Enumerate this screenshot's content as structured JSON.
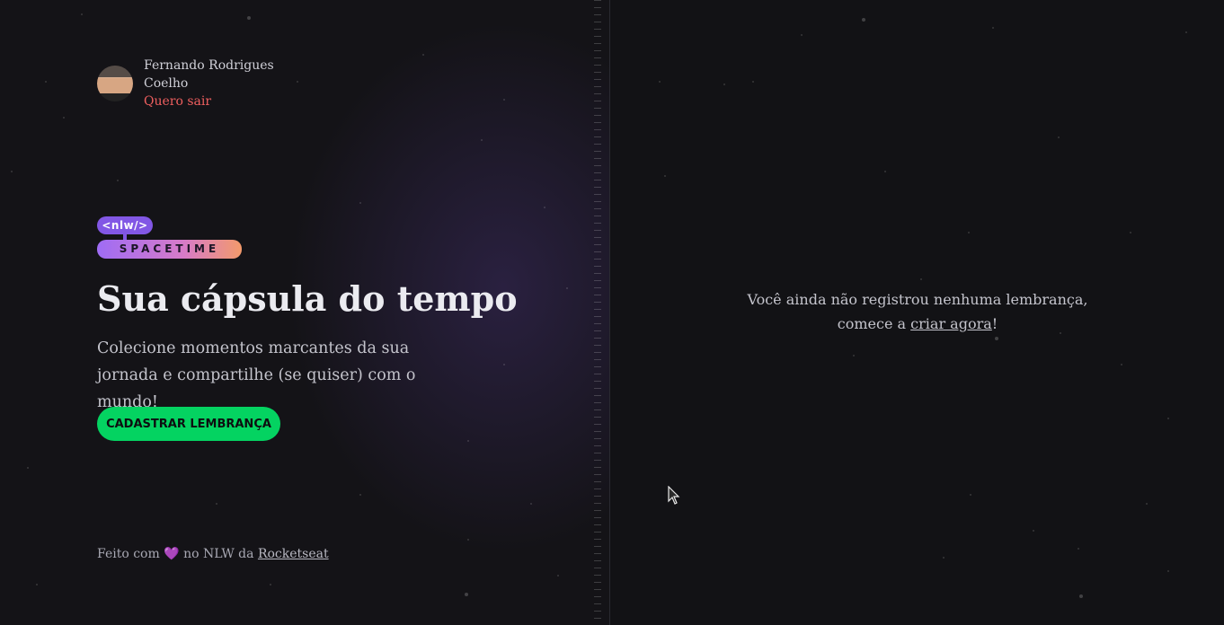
{
  "user": {
    "name_line1": "Fernando Rodrigues",
    "name_line2": "Coelho",
    "logout_label": "Quero sair"
  },
  "logo": {
    "top_text": "<nlw/>",
    "bottom_text": "SPACETIME"
  },
  "hero": {
    "title": "Sua cápsula do tempo",
    "subtitle": "Colecione momentos marcantes da sua jornada e compartilhe (se quiser) com o mundo!",
    "cta_label": "CADASTRAR LEMBRANÇA"
  },
  "footer": {
    "prefix": "Feito com",
    "heart": "💜",
    "middle": "no NLW da",
    "link_label": "Rocketseat"
  },
  "empty_state": {
    "message": "Você ainda não registrou nenhuma lembrança, comece a",
    "link_label": "criar agora",
    "suffix": "!"
  },
  "colors": {
    "accent_purple": "#8257e5",
    "cta_green": "#04d361",
    "logout_red": "#ef5f5f",
    "background": "#121215"
  },
  "icons": {
    "avatar": "user-avatar",
    "cursor": "mouse-pointer-icon"
  }
}
